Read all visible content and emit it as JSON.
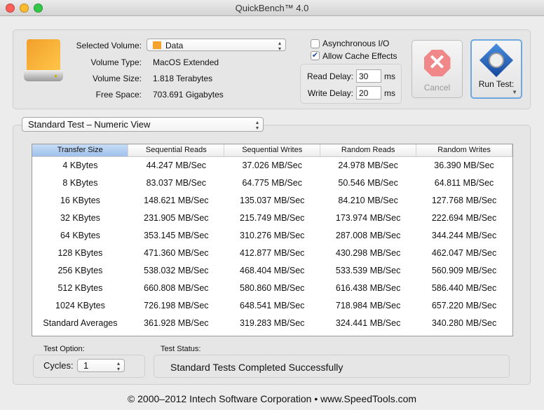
{
  "window": {
    "title": "QuickBench™ 4.0"
  },
  "volume": {
    "selected_label": "Selected Volume:",
    "selected_value": "Data",
    "type_label": "Volume Type:",
    "type_value": "MacOS Extended",
    "size_label": "Volume Size:",
    "size_value": "1.818 Terabytes",
    "free_label": "Free Space:",
    "free_value": "703.691 Gigabytes"
  },
  "options": {
    "async_label": "Asynchronous I/O",
    "async_checked": false,
    "cache_label": "Allow Cache Effects",
    "cache_checked": true,
    "read_delay_label": "Read Delay:",
    "read_delay_value": "30",
    "write_delay_label": "Write Delay:",
    "write_delay_value": "20",
    "unit": "ms"
  },
  "buttons": {
    "cancel": "Cancel",
    "run": "Run Test:"
  },
  "view": {
    "selected": "Standard Test – Numeric View"
  },
  "table": {
    "columns": [
      "Transfer Size",
      "Sequential Reads",
      "Sequential Writes",
      "Random Reads",
      "Random Writes"
    ],
    "rows": [
      [
        "4 KBytes",
        "44.247 MB/Sec",
        "37.026 MB/Sec",
        "24.978 MB/Sec",
        "36.390 MB/Sec"
      ],
      [
        "8 KBytes",
        "83.037 MB/Sec",
        "64.775 MB/Sec",
        "50.546 MB/Sec",
        "64.811 MB/Sec"
      ],
      [
        "16 KBytes",
        "148.621 MB/Sec",
        "135.037 MB/Sec",
        "84.210 MB/Sec",
        "127.768 MB/Sec"
      ],
      [
        "32 KBytes",
        "231.905 MB/Sec",
        "215.749 MB/Sec",
        "173.974 MB/Sec",
        "222.694 MB/Sec"
      ],
      [
        "64 KBytes",
        "353.145 MB/Sec",
        "310.276 MB/Sec",
        "287.008 MB/Sec",
        "344.244 MB/Sec"
      ],
      [
        "128 KBytes",
        "471.360 MB/Sec",
        "412.877 MB/Sec",
        "430.298 MB/Sec",
        "462.047 MB/Sec"
      ],
      [
        "256 KBytes",
        "538.032 MB/Sec",
        "468.404 MB/Sec",
        "533.539 MB/Sec",
        "560.909 MB/Sec"
      ],
      [
        "512 KBytes",
        "660.808 MB/Sec",
        "580.860 MB/Sec",
        "616.438 MB/Sec",
        "586.440 MB/Sec"
      ],
      [
        "1024 KBytes",
        "726.198 MB/Sec",
        "648.541 MB/Sec",
        "718.984 MB/Sec",
        "657.220 MB/Sec"
      ],
      [
        "Standard Averages",
        "361.928 MB/Sec",
        "319.283 MB/Sec",
        "324.441 MB/Sec",
        "340.280 MB/Sec"
      ]
    ]
  },
  "test_option": {
    "label": "Test Option:",
    "cycles_label": "Cycles:",
    "cycles_value": "1"
  },
  "status": {
    "label": "Test Status:",
    "text": "Standard Tests Completed Successfully"
  },
  "footer": "© 2000–2012 Intech Software Corporation • www.SpeedTools.com"
}
